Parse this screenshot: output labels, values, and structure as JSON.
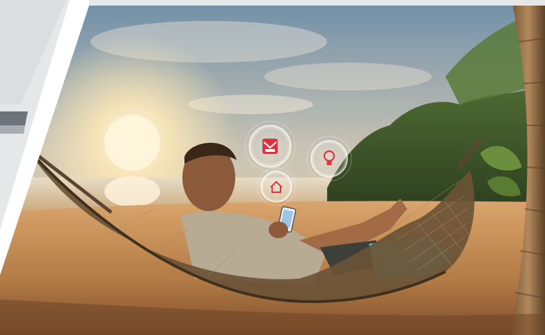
{
  "palette": {
    "left_panel": "#e6e7e9",
    "sky_top": "#6f8fa8",
    "sky_glow": "#f4ddb0",
    "sun": "#fff6dc",
    "sea": "#d7c7a8",
    "sand": "#c9945f",
    "sand_dark": "#8a5a33",
    "trees": "#3f5a2a",
    "hammock": "#6b5236",
    "shirt": "#b7ab93",
    "towel": "#5fc4b0",
    "icon_red": "#e0323c"
  },
  "floating_icons": [
    {
      "name": "envelope-icon"
    },
    {
      "name": "lightbulb-icon"
    },
    {
      "name": "home-icon"
    }
  ]
}
